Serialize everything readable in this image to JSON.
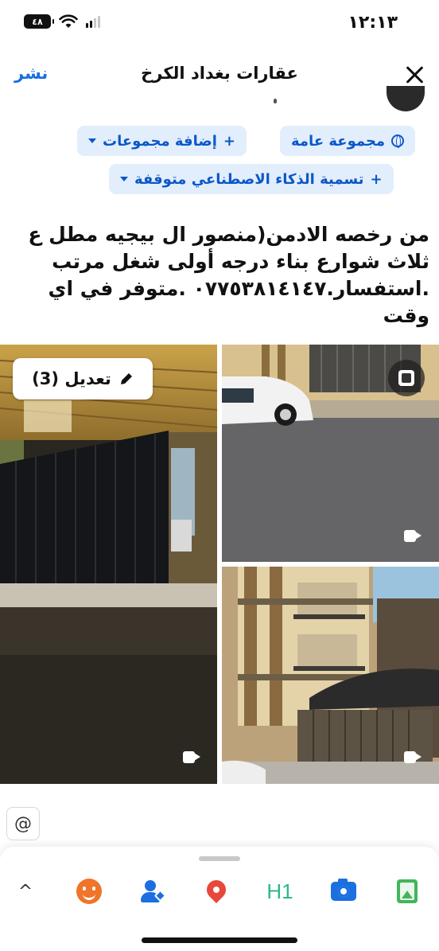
{
  "status_bar": {
    "time": "١٢:١٣",
    "battery": "٤٨",
    "wifi_icon": "wifi-icon",
    "signal_icon": "signal-icon"
  },
  "header": {
    "title": "عقارات بغداد الكرخ",
    "post_label": "نشر",
    "close_icon": "close-icon"
  },
  "chips": {
    "audience": "مجموعة عامة",
    "add_groups": "إضافة مجموعات",
    "ai_label": "تسمية الذكاء الاصطناعي متوقفة"
  },
  "post": {
    "text": "من رخصه الادمن(منصور ال بيجيه مطل ع ثلاث شوارع بناء درجه أولى شغل مرتب .استفسار.٠٧٧٥٣٨١٤١٤٧ .متوفر في اي وقت"
  },
  "media": {
    "edit_label": "تعديل (3)",
    "items": [
      {
        "type": "video",
        "icon": "video-camera-icon"
      },
      {
        "type": "video",
        "icon": "video-camera-icon"
      },
      {
        "type": "video",
        "icon": "video-camera-icon"
      }
    ]
  },
  "mention_symbol": "@",
  "toolbar": {
    "items": [
      {
        "name": "chevron-up-icon",
        "label": "^"
      },
      {
        "name": "feeling-icon"
      },
      {
        "name": "tag-people-icon"
      },
      {
        "name": "check-in-icon"
      },
      {
        "name": "heading-icon",
        "label": "H1"
      },
      {
        "name": "camera-icon"
      },
      {
        "name": "photo-icon"
      }
    ]
  },
  "colors": {
    "accent": "#1b6fe0",
    "chip_bg": "#e3eefc",
    "chip_text": "#0b57c9",
    "feeling": "#f0742a",
    "location": "#e8473b",
    "heading": "#2bb88e",
    "photo": "#43b55b"
  }
}
